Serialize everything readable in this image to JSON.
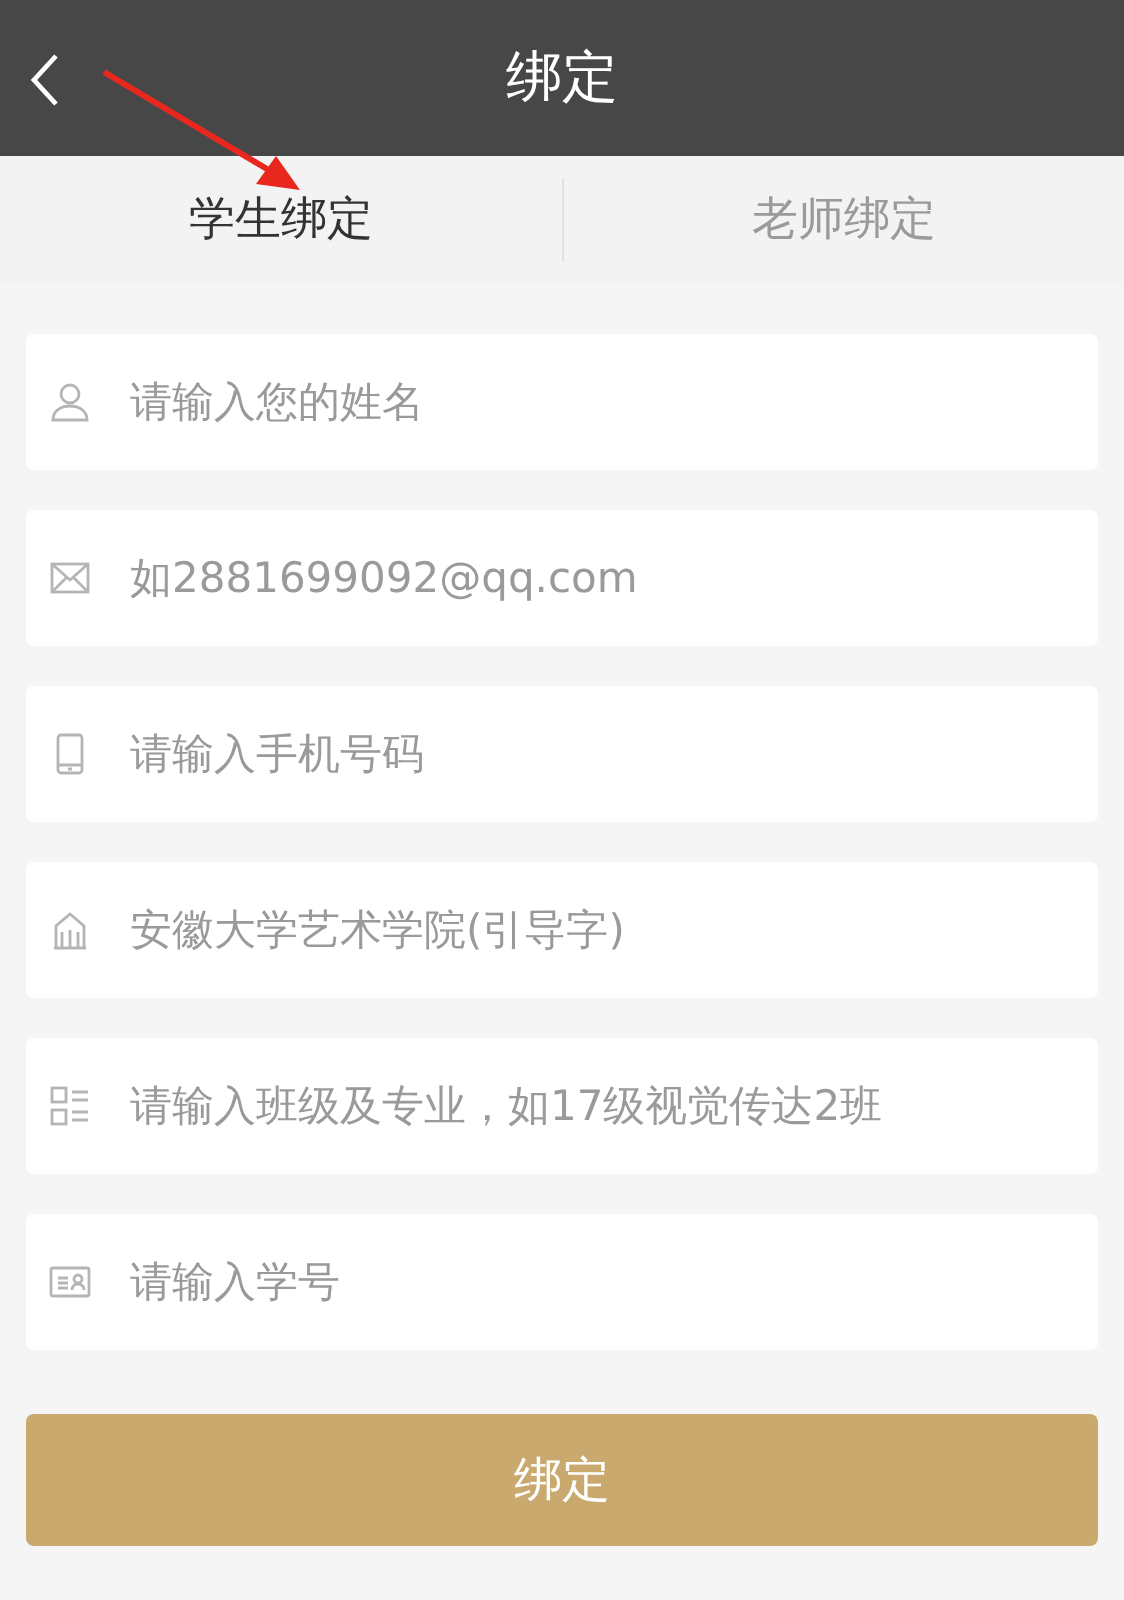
{
  "header": {
    "title": "绑定"
  },
  "tabs": [
    {
      "label": "学生绑定",
      "selected": true
    },
    {
      "label": "老师绑定",
      "selected": false
    }
  ],
  "fields": [
    {
      "kind": "person",
      "placeholder": "请输入您的姓名"
    },
    {
      "kind": "mail",
      "placeholder": "如2881699092@qq.com"
    },
    {
      "kind": "phone",
      "placeholder": "请输入手机号码"
    },
    {
      "kind": "school",
      "placeholder": "安徽大学艺术学院(引导字)"
    },
    {
      "kind": "list",
      "placeholder": "请输入班级及专业，如17级视觉传达2班"
    },
    {
      "kind": "card",
      "placeholder": "请输入学号"
    }
  ],
  "submit": {
    "label": "绑定"
  }
}
